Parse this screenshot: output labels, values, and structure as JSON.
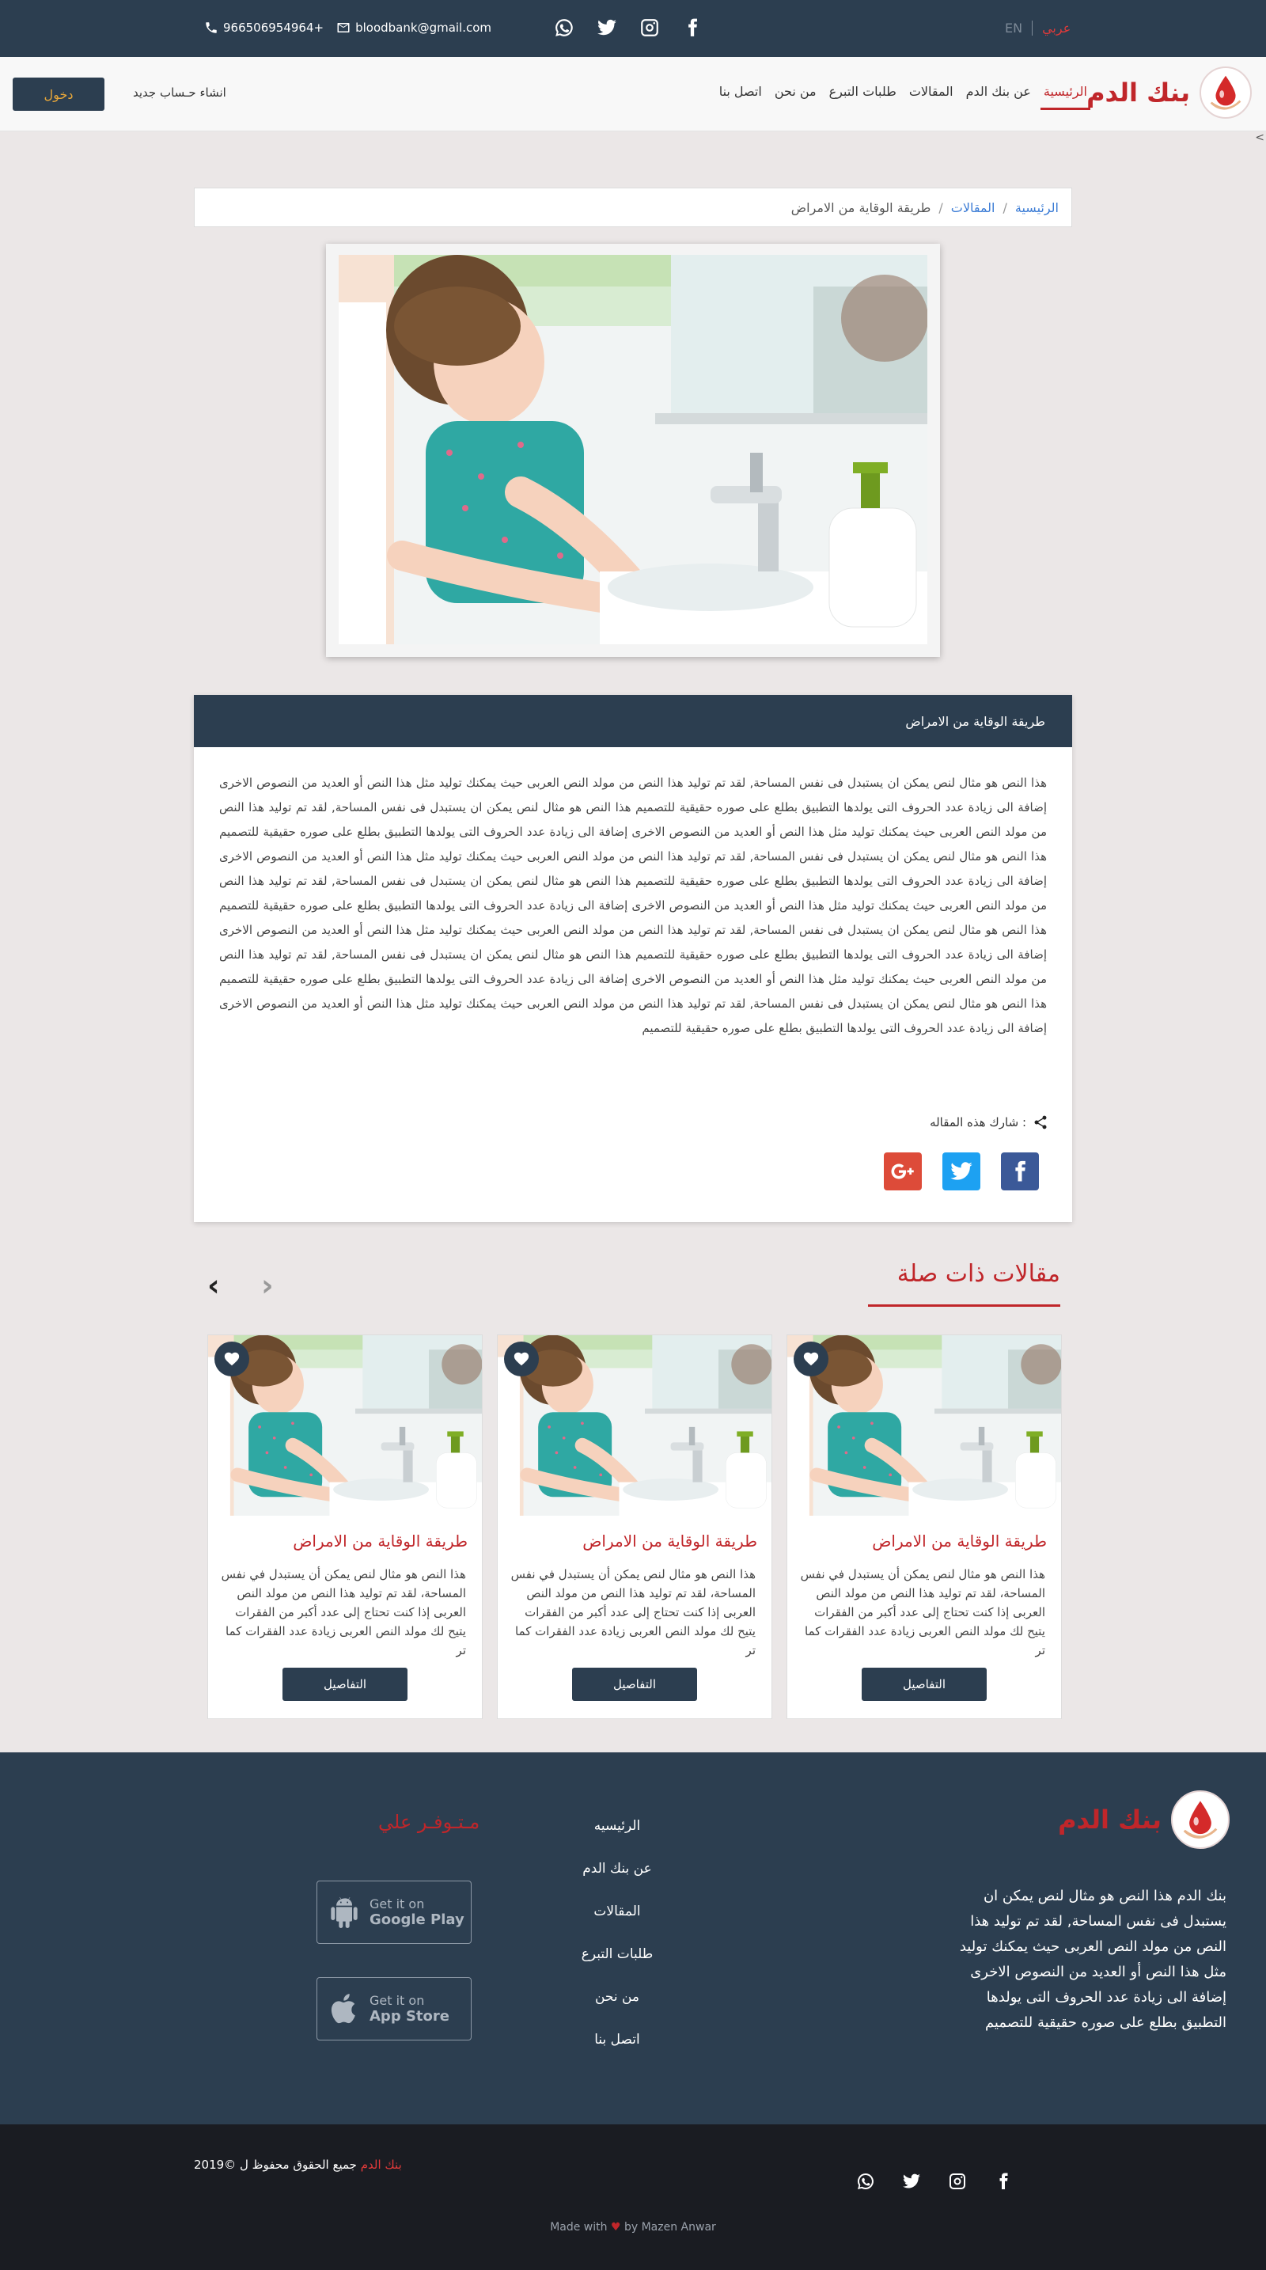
{
  "topbar": {
    "phone": "966506954964+",
    "email": "bloodbank@gmail.com",
    "lang_en": "EN",
    "lang_ar": "عربي",
    "social_icons": [
      "whatsapp-icon",
      "twitter-icon",
      "instagram-icon",
      "facebook-icon"
    ]
  },
  "nav": {
    "brand": "بنك الدم",
    "login": "دخول",
    "register": "انشاء حـساب جديد",
    "items": [
      {
        "label": "اتصل بنا"
      },
      {
        "label": "من نحن"
      },
      {
        "label": "طلبات التبرع"
      },
      {
        "label": "المقالات"
      },
      {
        "label": "عن بنك الدم"
      },
      {
        "label": "الرئيسية"
      }
    ],
    "caret": "<"
  },
  "breadcrumb": {
    "home": "الرئيسية",
    "articles": "المقالات",
    "current": "طريقة الوقاية من الامراض",
    "sep": "/"
  },
  "article": {
    "title": "طريقة الوقاية من الامراض",
    "body": "هذا النص هو مثال لنص يمكن ان يستبدل فى نفس المساحة, لقد تم توليد هذا النص من مولد النص العربى حيث يمكنك توليد مثل هذا النص أو العديد من النصوص الاخرى إضافة الى زيادة عدد الحروف التى يولدها التطبيق بطلع على صوره حقيقية للتصميم هذا النص هو مثال لنص يمكن ان يستبدل فى نفس المساحة, لقد تم توليد هذا النص من مولد النص العربى حيث يمكنك توليد مثل هذا النص أو العديد من النصوص الاخرى إضافة الى زيادة عدد الحروف التى يولدها التطبيق بطلع على صوره حقيقية للتصميم هذا النص هو مثال لنص يمكن ان يستبدل فى نفس المساحة, لقد تم توليد هذا النص من مولد النص العربى حيث يمكنك توليد مثل هذا النص أو العديد من النصوص الاخرى إضافة الى زيادة عدد الحروف التى يولدها التطبيق بطلع على صوره حقيقية للتصميم هذا النص هو مثال لنص يمكن ان يستبدل فى نفس المساحة, لقد تم توليد هذا النص من مولد النص العربى حيث يمكنك توليد مثل هذا النص أو العديد من النصوص الاخرى إضافة الى زيادة عدد الحروف التى يولدها التطبيق بطلع على صوره حقيقية للتصميم هذا النص هو مثال لنص يمكن ان يستبدل فى نفس المساحة, لقد تم توليد هذا النص من مولد النص العربى حيث يمكنك توليد مثل هذا النص أو العديد من النصوص الاخرى إضافة الى زيادة عدد الحروف التى يولدها التطبيق بطلع على صوره حقيقية للتصميم هذا النص هو مثال لنص يمكن ان يستبدل فى نفس المساحة, لقد تم توليد هذا النص من مولد النص العربى حيث يمكنك توليد مثل هذا النص أو العديد من النصوص الاخرى إضافة الى زيادة عدد الحروف التى يولدها التطبيق بطلع على صوره حقيقية للتصميم هذا النص هو مثال لنص يمكن ان يستبدل فى نفس المساحة, لقد تم توليد هذا النص من مولد النص العربى حيث يمكنك توليد مثل هذا النص أو العديد من النصوص الاخرى إضافة الى زيادة عدد الحروف التى يولدها التطبيق بطلع على صوره حقيقية للتصميم",
    "share_label": "شارك هذه المقاله :",
    "share_buttons": [
      {
        "icon": "google-plus-icon",
        "color": "#dd4b39"
      },
      {
        "icon": "twitter-icon",
        "color": "#1da1f2"
      },
      {
        "icon": "facebook-icon",
        "color": "#3b5998"
      }
    ]
  },
  "related": {
    "title": "مقالات ذات صلة",
    "prev": "‹",
    "next": "›",
    "cards": [
      {
        "title": "طريقة الوقاية من الامراض",
        "desc": "هذا النص هو مثال لنص يمكن أن يستبدل في نفس المساحة، لقد تم توليد هذا النص من مولد النص العربى إذا كنت تحتاج إلى عدد أكبر من الفقرات يتيح لك مولد النص العربى زيادة عدد الفقرات كما تر",
        "button": "التفاصيل"
      },
      {
        "title": "طريقة الوقاية من الامراض",
        "desc": "هذا النص هو مثال لنص يمكن أن يستبدل في نفس المساحة، لقد تم توليد هذا النص من مولد النص العربى إذا كنت تحتاج إلى عدد أكبر من الفقرات يتيح لك مولد النص العربى زيادة عدد الفقرات كما تر",
        "button": "التفاصيل"
      },
      {
        "title": "طريقة الوقاية من الامراض",
        "desc": "هذا النص هو مثال لنص يمكن أن يستبدل في نفس المساحة، لقد تم توليد هذا النص من مولد النص العربى إذا كنت تحتاج إلى عدد أكبر من الفقرات يتيح لك مولد النص العربى زيادة عدد الفقرات كما تر",
        "button": "التفاصيل"
      }
    ]
  },
  "footer": {
    "brand": "بنك الدم",
    "desc": "بنك الدم هذا النص هو مثال لنص يمكن ان يستبدل فى نفس المساحة, لقد تم توليد هذا النص من مولد النص العربى حيث يمكنك توليد مثل هذا النص أو العديد من النصوص الاخرى إضافة الى زيادة عدد الحروف التى يولدها التطبيق بطلع على صوره حقيقية للتصميم",
    "links": [
      "الرئيسيه",
      "عن بنك الدم",
      "المقالات",
      "طلبات التبرع",
      "من نحن",
      "اتصل بنا"
    ],
    "available": "مـتـوفـر علي",
    "google_play": {
      "top": "Get it on",
      "bottom": "Google Play"
    },
    "app_store": {
      "top": "Get it on",
      "bottom": "App Store"
    }
  },
  "bottombar": {
    "copy_prefix": "جميع الحقوق محفوظ ل",
    "copy_brand": "بنك الدم",
    "copy_year": "2019©",
    "made_prefix": "Made with",
    "made_heart": "♥",
    "made_suffix": "by Mazen Anwar",
    "social_icons": [
      "whatsapp-icon",
      "twitter-icon",
      "instagram-icon",
      "facebook-icon"
    ]
  },
  "colors": {
    "primary": "#2c3e50",
    "accent": "#c0262a",
    "background": "#ebe7e7"
  }
}
